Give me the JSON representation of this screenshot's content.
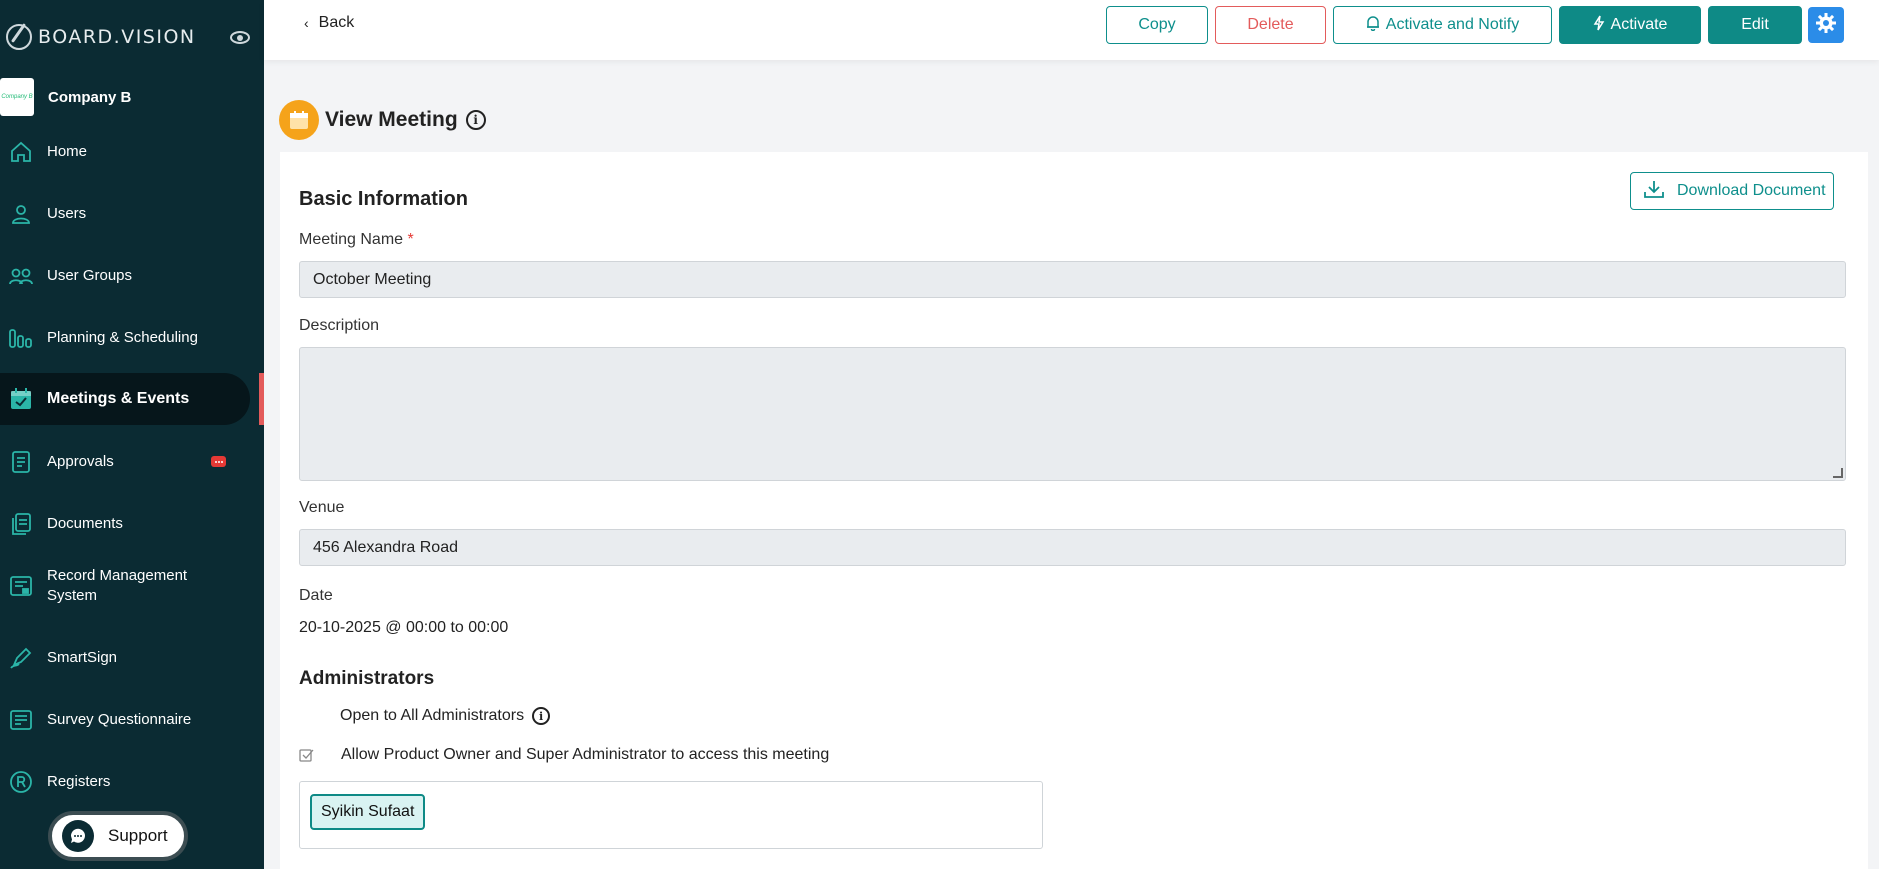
{
  "brand": {
    "name": "BOARD.VISION"
  },
  "company": {
    "name": "Company B",
    "logo_text": "Company B"
  },
  "sidebar": {
    "items": [
      {
        "label": "Home",
        "icon": "home-icon"
      },
      {
        "label": "Users",
        "icon": "user-icon"
      },
      {
        "label": "User Groups",
        "icon": "users-icon"
      },
      {
        "label": "Planning & Scheduling",
        "icon": "bar-chart-icon"
      },
      {
        "label": "Meetings & Events",
        "icon": "calendar-check-icon",
        "active": true
      },
      {
        "label": "Approvals",
        "icon": "document-list-icon"
      },
      {
        "label": "Documents",
        "icon": "documents-icon"
      },
      {
        "label": "Record Management System",
        "icon": "record-icon"
      },
      {
        "label": "SmartSign",
        "icon": "pen-icon"
      },
      {
        "label": "Survey Questionnaire",
        "icon": "checklist-icon"
      },
      {
        "label": "Registers",
        "icon": "registered-icon"
      }
    ],
    "support_label": "Support"
  },
  "topbar": {
    "back_label": "Back",
    "copy_label": "Copy",
    "delete_label": "Delete",
    "activate_notify_label": "Activate and Notify",
    "activate_label": "Activate",
    "edit_label": "Edit"
  },
  "page": {
    "title": "View Meeting"
  },
  "form": {
    "section_basic": "Basic Information",
    "download_label": "Download Document",
    "meeting_name_label": "Meeting Name",
    "meeting_name_required": "*",
    "meeting_name_value": "October Meeting",
    "description_label": "Description",
    "description_value": "",
    "venue_label": "Venue",
    "venue_value": "456 Alexandra Road",
    "date_label": "Date",
    "date_value": "20-10-2025 @ 00:00 to 00:00",
    "section_admins": "Administrators",
    "open_all_label": "Open to All Administrators",
    "allow_owner_label": "Allow Product Owner and Super Administrator to access this meeting",
    "admin_chips": [
      "Syikin Sufaat"
    ]
  },
  "colors": {
    "sidebar_bg": "#0b2b33",
    "accent_teal": "#0e8a86",
    "danger": "#e35b5b",
    "gear_blue": "#2b8ce8",
    "calendar_orange": "#f5a31a"
  }
}
